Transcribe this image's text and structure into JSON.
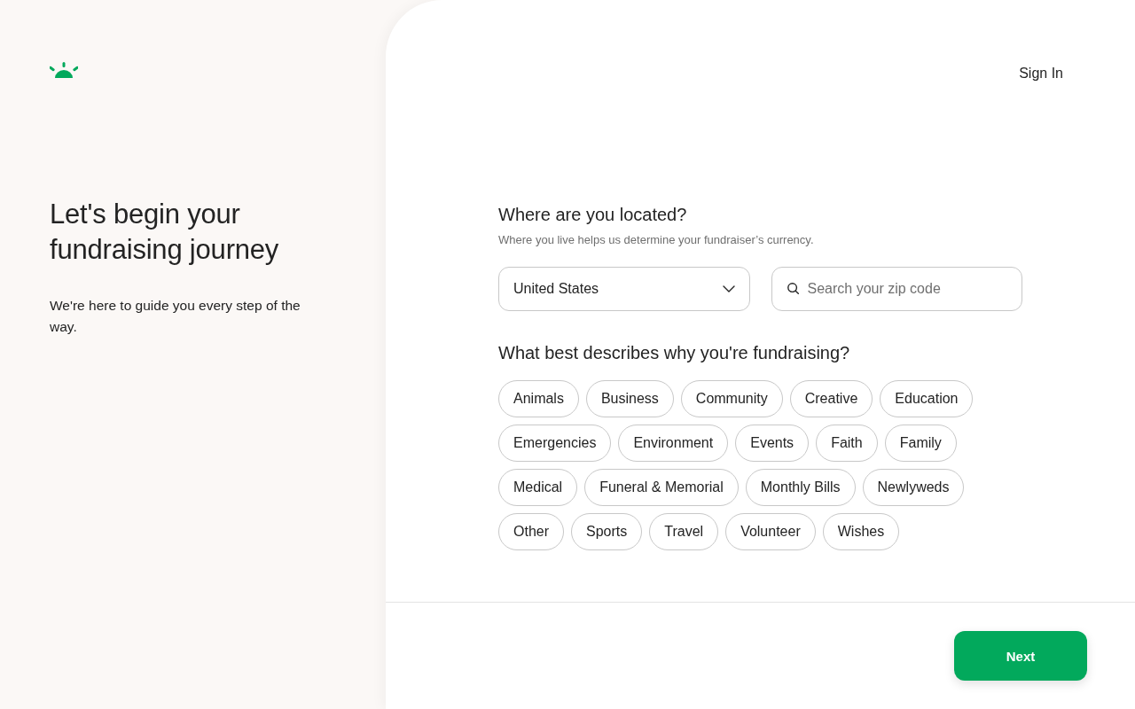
{
  "header": {
    "sign_in": "Sign In"
  },
  "intro": {
    "title": "Let's begin your fundraising journey",
    "text": "We're here to guide you every step of the way."
  },
  "location": {
    "question": "Where are you located?",
    "hint": "Where you live helps us determine your fundraiser’s currency.",
    "country": {
      "value": "United States"
    },
    "zip": {
      "placeholder": "Search your zip code"
    }
  },
  "category": {
    "question": "What best describes why you're fundraising?",
    "options": [
      {
        "label": "Animals",
        "selected": false
      },
      {
        "label": "Business",
        "selected": false
      },
      {
        "label": "Community",
        "selected": false
      },
      {
        "label": "Creative",
        "selected": false
      },
      {
        "label": "Education",
        "selected": false
      },
      {
        "label": "Emergencies",
        "selected": false
      },
      {
        "label": "Environment",
        "selected": false
      },
      {
        "label": "Events",
        "selected": false
      },
      {
        "label": "Faith",
        "selected": false
      },
      {
        "label": "Family",
        "selected": false
      },
      {
        "label": "Medical",
        "selected": false
      },
      {
        "label": "Funeral & Memorial",
        "selected": false
      },
      {
        "label": "Monthly Bills",
        "selected": false
      },
      {
        "label": "Newlyweds",
        "selected": false
      },
      {
        "label": "Other",
        "selected": false
      },
      {
        "label": "Sports",
        "selected": false
      },
      {
        "label": "Travel",
        "selected": false
      },
      {
        "label": "Volunteer",
        "selected": false
      },
      {
        "label": "Wishes",
        "selected": false
      }
    ]
  },
  "footer": {
    "next": "Next"
  }
}
